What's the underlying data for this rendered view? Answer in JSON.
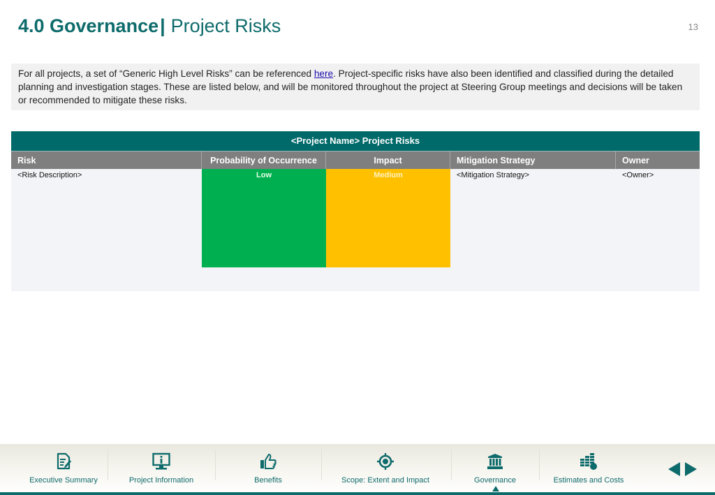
{
  "header": {
    "section": "4.0 Governance",
    "separator": "|",
    "subtitle": "Project Risks",
    "page_number": "13"
  },
  "intro": {
    "text_before_link": "For all projects, a set of “Generic High Level Risks” can be referenced ",
    "link_text": "here",
    "text_after_link": ". Project-specific risks have also been identified and classified during the detailed planning and investigation stages. These are listed below, and will be monitored throughout the project at Steering Group meetings and decisions will be taken or recommended to mitigate these risks."
  },
  "risk_table": {
    "title": "<Project Name> Project Risks",
    "columns": [
      "Risk",
      "Probability of Occurrence",
      "Impact",
      "Mitigation Strategy",
      "Owner"
    ],
    "rows": [
      {
        "risk": "<Risk Description>",
        "probability": "Low",
        "impact": "Medium",
        "mitigation": "<Mitigation Strategy>",
        "owner": "<Owner>"
      }
    ],
    "colors": {
      "title_bg": "#006a6a",
      "header_bg": "#7f7f7f",
      "low": "#00b050",
      "medium": "#ffc000"
    }
  },
  "footer_nav": {
    "items": [
      {
        "label": "Executive Summary",
        "icon": "document-edit-icon"
      },
      {
        "label": "Project Information",
        "icon": "monitor-info-icon"
      },
      {
        "label": "Benefits",
        "icon": "thumbs-up-icon"
      },
      {
        "label": "Scope: Extent and Impact",
        "icon": "target-icon"
      },
      {
        "label": "Governance",
        "icon": "institution-icon",
        "active": true
      },
      {
        "label": "Estimates and Costs",
        "icon": "coins-stack-icon"
      }
    ],
    "prev_label": "previous",
    "next_label": "next",
    "accent": "#0e6b6b"
  }
}
